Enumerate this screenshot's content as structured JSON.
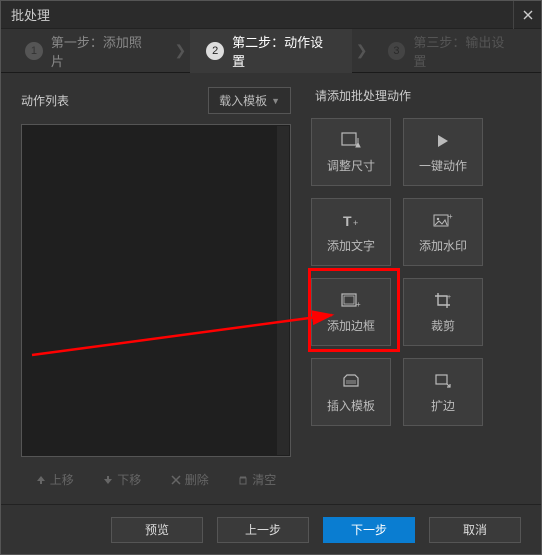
{
  "window": {
    "title": "批处理"
  },
  "steps": {
    "s1": {
      "num": "1",
      "label": "第一步：添加照片"
    },
    "s2": {
      "num": "2",
      "label": "第二步：动作设置"
    },
    "s3": {
      "num": "3",
      "label": "第三步：输出设置"
    }
  },
  "actionList": {
    "header": "动作列表",
    "loadTemplate": "载入模板"
  },
  "listControls": {
    "moveUp": "上移",
    "moveDown": "下移",
    "delete": "删除",
    "clear": "清空"
  },
  "rightPanel": {
    "header": "请添加批处理动作"
  },
  "actions": {
    "resize": "调整尺寸",
    "oneKey": "一键动作",
    "addText": "添加文字",
    "addWatermark": "添加水印",
    "addBorder": "添加边框",
    "crop": "裁剪",
    "insertTemplate": "插入模板",
    "extend": "扩边"
  },
  "footer": {
    "preview": "预览",
    "prev": "上一步",
    "next": "下一步",
    "cancel": "取消"
  }
}
